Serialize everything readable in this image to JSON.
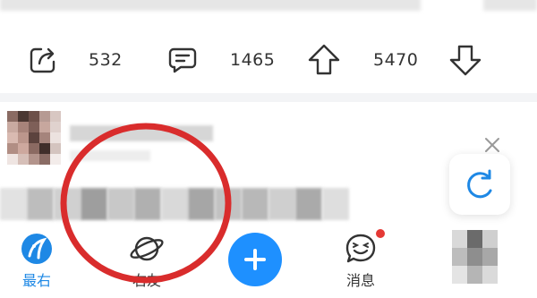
{
  "action_bar": {
    "share_icon": "share-icon",
    "share_count": "532",
    "comment_icon": "comment-icon",
    "comment_count": "1465",
    "upvote_icon": "upvote-icon",
    "upvote_count": "5470",
    "downvote_icon": "downvote-icon"
  },
  "floating": {
    "close_icon": "close-icon",
    "refresh_icon": "refresh-icon"
  },
  "tab_bar": {
    "tabs": [
      {
        "label": "最右",
        "icon": "squid-logo-icon",
        "active": true
      },
      {
        "label": "右友",
        "icon": "planet-icon",
        "active": false
      },
      {
        "label": "",
        "icon": "plus-icon",
        "active": false
      },
      {
        "label": "消息",
        "icon": "smiley-message-icon",
        "active": false,
        "badge": true
      }
    ]
  },
  "colors": {
    "accent": "#1e88e5",
    "plus_button": "#1e90ff",
    "badge": "#e53935",
    "annotation_circle": "#d92c2c",
    "divider": "#f3f4f6"
  }
}
